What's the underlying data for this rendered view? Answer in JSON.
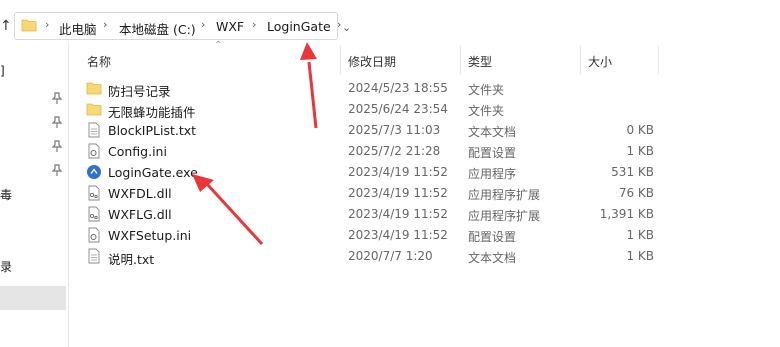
{
  "breadcrumb": {
    "items": [
      "此电脑",
      "本地磁盘 (C:)",
      "WXF",
      "LoginGate"
    ]
  },
  "sidebar": {
    "fragments": [
      "]",
      "毒",
      "录"
    ]
  },
  "columns": {
    "name": "名称",
    "date": "修改日期",
    "type": "类型",
    "size": "大小"
  },
  "files": [
    {
      "name": "防扫号记录",
      "date": "2024/5/23 18:55",
      "type": "文件夹",
      "size": "",
      "icon": "folder-icon"
    },
    {
      "name": "无限蜂功能插件",
      "date": "2025/6/24 23:54",
      "type": "文件夹",
      "size": "",
      "icon": "folder-icon"
    },
    {
      "name": "BlockIPList.txt",
      "date": "2025/7/3 11:03",
      "type": "文本文档",
      "size": "0 KB",
      "icon": "text-file-icon"
    },
    {
      "name": "Config.ini",
      "date": "2025/7/2 21:28",
      "type": "配置设置",
      "size": "1 KB",
      "icon": "settings-file-icon"
    },
    {
      "name": "LoginGate.exe",
      "date": "2023/4/19 11:52",
      "type": "应用程序",
      "size": "531 KB",
      "icon": "app-exe-icon"
    },
    {
      "name": "WXFDL.dll",
      "date": "2023/4/19 11:52",
      "type": "应用程序扩展",
      "size": "76 KB",
      "icon": "dll-file-icon"
    },
    {
      "name": "WXFLG.dll",
      "date": "2023/4/19 11:52",
      "type": "应用程序扩展",
      "size": "1,391 KB",
      "icon": "dll-file-icon"
    },
    {
      "name": "WXFSetup.ini",
      "date": "2023/4/19 11:52",
      "type": "配置设置",
      "size": "1 KB",
      "icon": "settings-file-icon"
    },
    {
      "name": "说明.txt",
      "date": "2020/7/7 1:20",
      "type": "文本文档",
      "size": "1 KB",
      "icon": "text-file-icon"
    }
  ],
  "colors": {
    "folder": "#f8d775",
    "accent_arrow": "#e8363a",
    "selection": "#e5e5e5"
  }
}
